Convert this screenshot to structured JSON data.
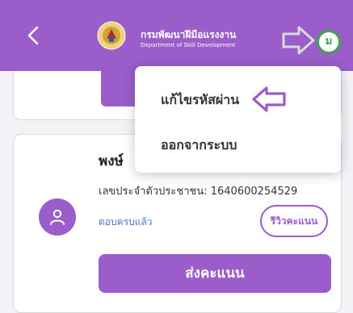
{
  "header": {
    "title_th": "กรมพัฒนาฝีมือแรงงาน",
    "title_en": "Department of Skill Development",
    "user_initial": "ม",
    "color": "#9a5dc9"
  },
  "menu": {
    "items": [
      {
        "label": "แก้ไขรหัสผ่าน"
      },
      {
        "label": "ออกจากระบบ"
      }
    ]
  },
  "card": {
    "name": "พงษ์",
    "id_label": "เลขประจำตัวประชาชน: 1640600254529",
    "status": "ตอบครบแล้ว",
    "review_label": "รีวิวคะแนน",
    "send_label": "ส่งคะแนน"
  },
  "icons": [
    "back-chevron-icon",
    "department-logo-icon",
    "hand-pointer-icon",
    "user-avatar-icon",
    "person-icon",
    "arrow-left-icon"
  ],
  "colors": {
    "accent": "#9a5dc9",
    "link": "#4a78c8",
    "avatar_ring": "#3fa34d"
  }
}
